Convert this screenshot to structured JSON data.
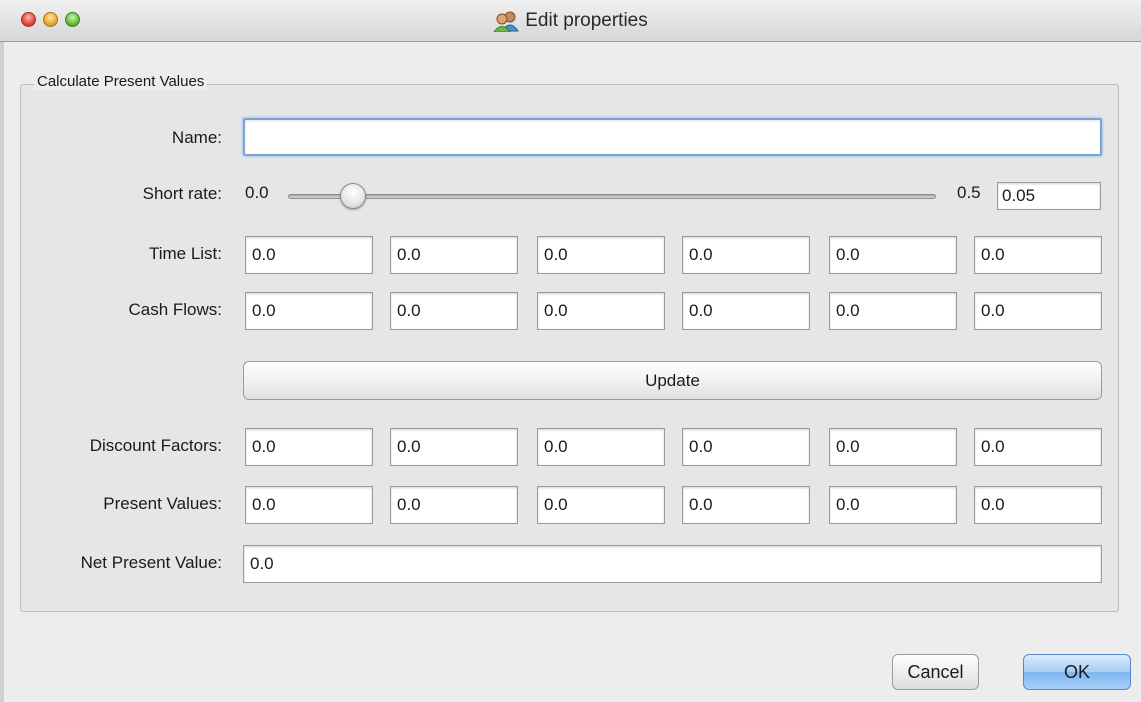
{
  "window": {
    "title": "Edit properties"
  },
  "group": {
    "title": "Calculate Present Values"
  },
  "name": {
    "label": "Name:",
    "value": ""
  },
  "short_rate": {
    "label": "Short rate:",
    "min_label": "0.0",
    "max_label": "0.5",
    "value": "0.05",
    "slider_fraction": 0.1
  },
  "time_list": {
    "label": "Time List:",
    "values": [
      "0.0",
      "0.0",
      "0.0",
      "0.0",
      "0.0",
      "0.0"
    ]
  },
  "cash_flows": {
    "label": "Cash Flows:",
    "values": [
      "0.0",
      "0.0",
      "0.0",
      "0.0",
      "0.0",
      "0.0"
    ]
  },
  "update_button": {
    "label": "Update"
  },
  "discount_factors": {
    "label": "Discount Factors:",
    "values": [
      "0.0",
      "0.0",
      "0.0",
      "0.0",
      "0.0",
      "0.0"
    ]
  },
  "present_values": {
    "label": "Present Values:",
    "values": [
      "0.0",
      "0.0",
      "0.0",
      "0.0",
      "0.0",
      "0.0"
    ]
  },
  "npv": {
    "label": "Net Present Value:",
    "value": "0.0"
  },
  "buttons": {
    "cancel": "Cancel",
    "ok": "OK"
  },
  "icons": {
    "title_icon": "users-icon"
  }
}
